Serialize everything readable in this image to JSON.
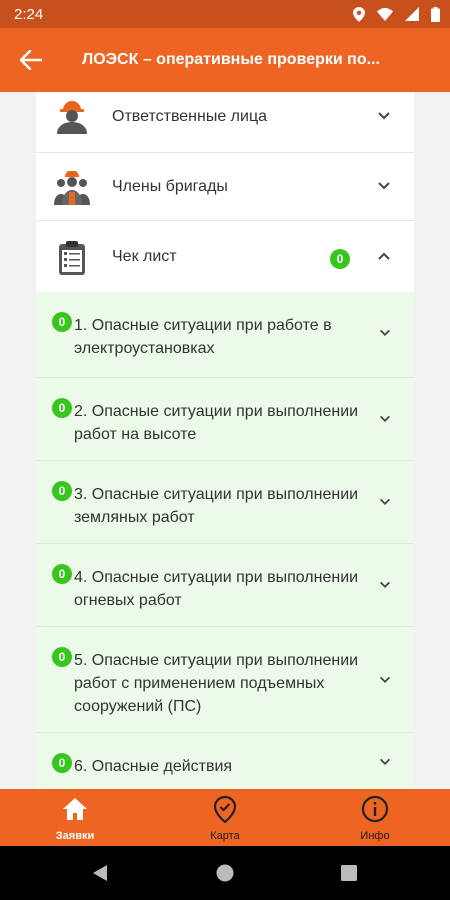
{
  "status": {
    "time": "2:24"
  },
  "appbar": {
    "title": "ЛОЭСК – оперативные проверки по..."
  },
  "sections": {
    "responsible": {
      "label": "Ответственные лица"
    },
    "brigade": {
      "label": "Члены бригады"
    },
    "checklist": {
      "label": "Чек лист",
      "badge": "0"
    }
  },
  "checklist_items": [
    {
      "text": "1. Опасные ситуации при работе в электроустановках",
      "badge": "0"
    },
    {
      "text": "2. Опасные ситуации при выполнении работ на высоте",
      "badge": "0"
    },
    {
      "text": "3. Опасные ситуации при выполнении земляных работ",
      "badge": "0"
    },
    {
      "text": "4. Опасные ситуации при выполнении огневых работ",
      "badge": "0"
    },
    {
      "text": "5. Опасные ситуации при выполнении работ с применением подъемных сооружений (ПС)",
      "badge": "0"
    },
    {
      "text": "6. Опасные действия",
      "badge": "0"
    }
  ],
  "bottom_nav": {
    "requests": "Заявки",
    "map": "Карта",
    "info": "Инфо"
  },
  "colors": {
    "primary": "#ed6423",
    "status": "#c8501d",
    "badge": "#38c51e",
    "section_bg": "#ecfbe9"
  }
}
